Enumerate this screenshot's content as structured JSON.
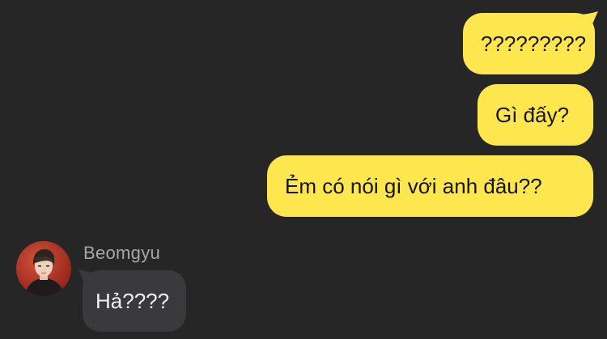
{
  "conversation": {
    "outgoing": [
      {
        "text": "?????????"
      },
      {
        "text": "Gì đấy?"
      },
      {
        "text": "Ẻm có nói gì với anh đâu??"
      }
    ],
    "incoming": {
      "sender_name": "Beomgyu",
      "messages": [
        {
          "text": "Hả????"
        }
      ]
    }
  },
  "colors": {
    "background": "#262627",
    "outgoing_bubble": "#FEE64E",
    "incoming_bubble": "#3A3A3C",
    "sender_name": "#A6A6A8"
  },
  "icons": {
    "avatar": "profile-photo"
  }
}
